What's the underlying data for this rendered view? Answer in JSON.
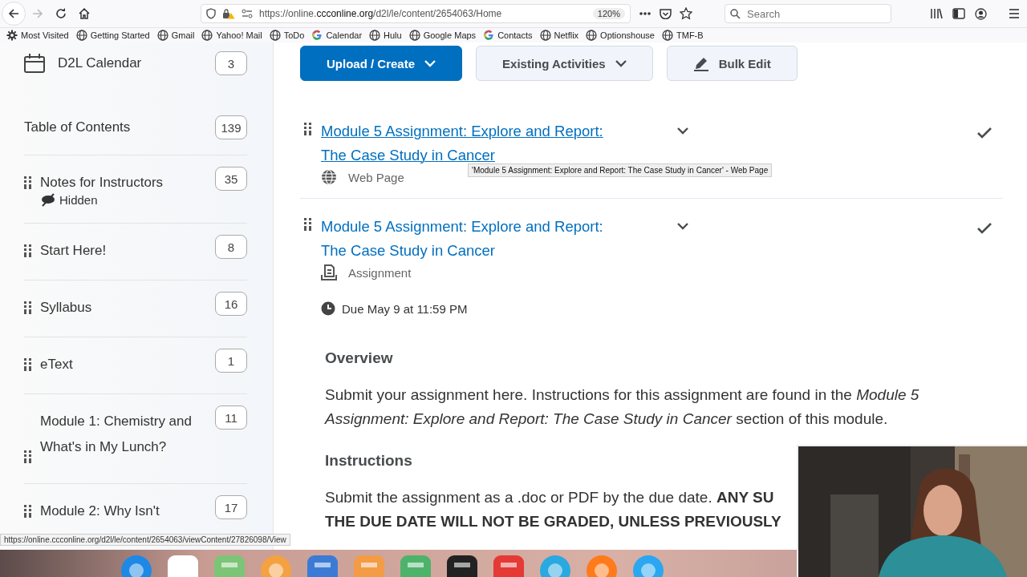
{
  "browser": {
    "url": {
      "prefix": "https://online.",
      "domain": "ccconline.org",
      "path": "/d2l/le/content/2654063/Home"
    },
    "zoom": "120%",
    "search": {
      "placeholder": "Search"
    }
  },
  "bookmarks": [
    {
      "label": "Most Visited",
      "kind": "gear"
    },
    {
      "label": "Getting Started",
      "kind": "globe"
    },
    {
      "label": "Gmail",
      "kind": "globe"
    },
    {
      "label": "Yahoo! Mail",
      "kind": "globe"
    },
    {
      "label": "ToDo",
      "kind": "globe"
    },
    {
      "label": "Calendar",
      "kind": "google"
    },
    {
      "label": "Hulu",
      "kind": "globe"
    },
    {
      "label": "Google Maps",
      "kind": "globe"
    },
    {
      "label": "Contacts",
      "kind": "google"
    },
    {
      "label": "Netflix",
      "kind": "globe"
    },
    {
      "label": "Optionshouse",
      "kind": "globe"
    },
    {
      "label": "TMF-B",
      "kind": "globe"
    }
  ],
  "sidebar": {
    "calendar": {
      "label": "D2L Calendar",
      "count": "3"
    },
    "toc": {
      "label": "Table of Contents",
      "count": "139"
    },
    "modules": [
      {
        "title": "Notes for Instructors",
        "count": "35",
        "hidden": true,
        "status": "Hidden"
      },
      {
        "title": "Start Here!",
        "count": "8",
        "hidden": false
      },
      {
        "title": "Syllabus",
        "count": "16",
        "hidden": false
      },
      {
        "title": "eText",
        "count": "1",
        "hidden": false
      },
      {
        "title": "Module 1: Chemistry and What's in My Lunch?",
        "count": "11",
        "hidden": false
      },
      {
        "title": "Module 2: Why Isn't",
        "count": "17",
        "hidden": false
      }
    ]
  },
  "toolbar": [
    {
      "label": "Upload / Create",
      "kind": "primary"
    },
    {
      "label": "Existing Activities",
      "kind": "dropdown"
    },
    {
      "label": "Bulk Edit",
      "kind": "edit"
    }
  ],
  "items": [
    {
      "title": "Module 5 Assignment: Explore and Report: The Case Study in Cancer",
      "kind": "webpage",
      "type": "Web Page",
      "completed": true
    },
    {
      "title": "Module 5 Assignment: Explore and Report: The Case Study in Cancer",
      "kind": "assignment",
      "type": "Assignment",
      "completed": true,
      "due": "Due May 9 at 11:59 PM"
    }
  ],
  "tooltip": "'Module 5 Assignment: Explore and Report: The Case Study in Cancer' - Web Page",
  "description": [
    {
      "heading": "Overview",
      "lines": [
        "Submit your assignment here. Instructions for this assignment are found in the *Module 5 Assignment: Explore and Report: The Case Study in Cancer* section of this module."
      ]
    },
    {
      "heading": "Instructions",
      "lines": [
        "Submit the assignment as a .doc or PDF by the due date. **ANY SU**",
        "**THE DUE DATE WILL NOT BE GRADED, UNLESS PREVIOUSLY**"
      ]
    }
  ],
  "status_url": "https://online.ccconline.org/d2l/le/content/2654063/viewContent/27826098/View"
}
